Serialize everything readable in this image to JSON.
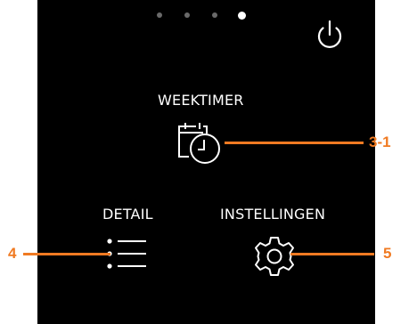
{
  "screen": {
    "pagination": {
      "count": 4,
      "active_index": 3
    },
    "power_button": {
      "icon": "power-icon"
    },
    "menu": {
      "weektimer": {
        "label": "WEEKTIMER",
        "icon": "calendar-clock-icon"
      },
      "detail": {
        "label": "DETAIL",
        "icon": "list-icon"
      },
      "settings": {
        "label": "INSTELLINGEN",
        "icon": "gear-icon"
      }
    }
  },
  "callouts": {
    "weektimer": "3-1",
    "detail": "4",
    "settings": "5"
  },
  "colors": {
    "screen_background": "#000000",
    "foreground": "#ffffff",
    "callout": "#f07a22",
    "inactive_dot": "#6a6a6a"
  }
}
